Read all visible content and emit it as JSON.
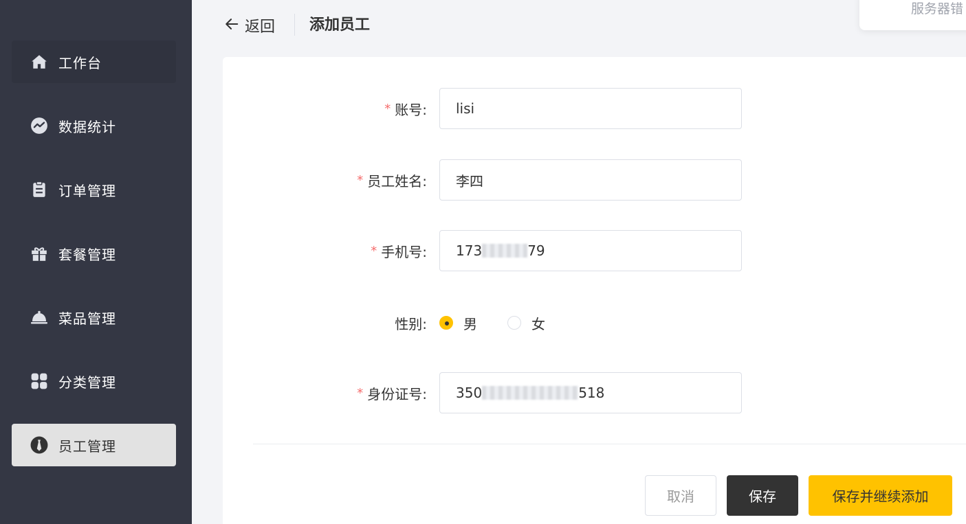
{
  "sidebar": {
    "items": [
      {
        "label": "工作台",
        "icon": "home-icon"
      },
      {
        "label": "数据统计",
        "icon": "chart-icon"
      },
      {
        "label": "订单管理",
        "icon": "clipboard-icon"
      },
      {
        "label": "套餐管理",
        "icon": "gift-icon"
      },
      {
        "label": "菜品管理",
        "icon": "cloche-icon"
      },
      {
        "label": "分类管理",
        "icon": "grid-icon"
      },
      {
        "label": "员工管理",
        "icon": "employee-icon"
      }
    ],
    "active_index": 6
  },
  "header": {
    "back_label": "返回",
    "title": "添加员工"
  },
  "toast": {
    "message": "服务器错"
  },
  "form": {
    "account": {
      "label": "账号:",
      "value": "lisi"
    },
    "name": {
      "label": "员工姓名:",
      "value": "李四"
    },
    "phone": {
      "label": "手机号:",
      "value_start": "173",
      "value_end": "79"
    },
    "gender": {
      "label": "性别:",
      "options": [
        "男",
        "女"
      ],
      "selected": "男"
    },
    "id_number": {
      "label": "身份证号:",
      "value_start": "350",
      "value_end": "518"
    },
    "required_mark": "*"
  },
  "actions": {
    "cancel": "取消",
    "save": "保存",
    "save_continue": "保存并继续添加"
  },
  "colors": {
    "sidebar_bg": "#343744",
    "accent": "#ffc200",
    "required": "#f56c6c",
    "dark_button": "#333333"
  }
}
